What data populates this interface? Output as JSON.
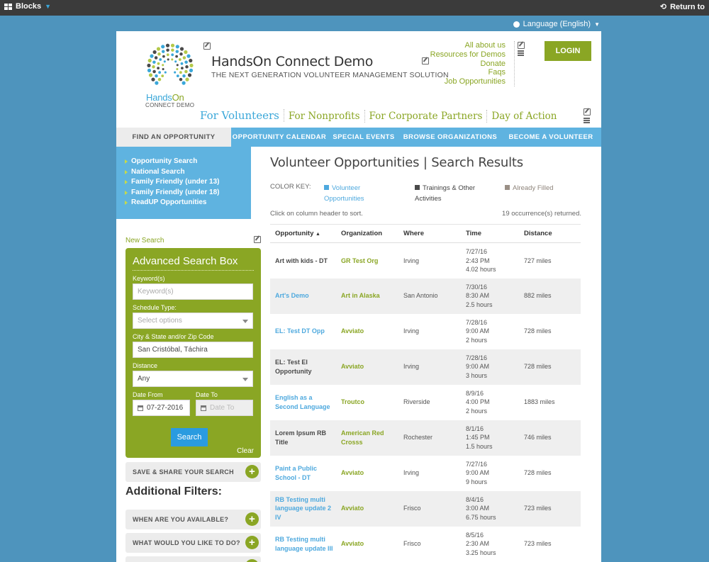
{
  "adminbar": {
    "blocks_label": "Blocks",
    "return_label": "Return to"
  },
  "language": {
    "label": "Language (English)"
  },
  "header": {
    "site_title": "HandsOn Connect Demo",
    "tagline": "THE NEXT GENERATION VOLUNTEER MANAGEMENT SOLUTION",
    "logo_text_a": "Hands",
    "logo_text_b": "On",
    "logo_sub": "CONNECT DEMO",
    "top_links": [
      "All about us",
      "Resources for Demos",
      "Donate",
      "Faqs",
      "Job Opportunities"
    ],
    "login_label": "LOGIN"
  },
  "main_nav": [
    "For Volunteers",
    "For Nonprofits",
    "For Corporate Partners",
    "Day of Action"
  ],
  "sub_nav": [
    "FIND AN OPPORTUNITY",
    "OPPORTUNITY CALENDAR",
    "SPECIAL EVENTS",
    "BROWSE ORGANIZATIONS",
    "BECOME A VOLUNTEER"
  ],
  "sidebar": {
    "links": [
      "Opportunity Search",
      "National Search",
      "Family Friendly (under 13)",
      "Family Friendly (under 18)",
      "ReadUP Opportunities"
    ],
    "new_search": "New Search"
  },
  "search_box": {
    "title": "Advanced Search Box",
    "keyword_label": "Keyword(s)",
    "keyword_placeholder": "Keyword(s)",
    "schedule_label": "Schedule Type:",
    "schedule_placeholder": "Select options",
    "location_label": "City & State and/or Zip Code",
    "location_value": "San Cristóbal, Táchira",
    "distance_label": "Distance",
    "distance_value": "Any",
    "date_from_label": "Date From",
    "date_from_value": "07-27-2016",
    "date_to_label": "Date To",
    "date_to_placeholder": "Date To",
    "search_label": "Search",
    "clear_label": "Clear"
  },
  "filters": {
    "save_share": "SAVE & SHARE YOUR SEARCH",
    "additional_title": "Additional Filters:",
    "when": "WHEN ARE YOU AVAILABLE?",
    "what": "WHAT WOULD YOU LIKE TO DO?"
  },
  "results": {
    "title": "Volunteer Opportunities | Search Results",
    "color_key_label": "COLOR KEY:",
    "color_key": [
      {
        "label_a": "Volunteer",
        "label_b": "Opportunities",
        "color": "#4ea9de"
      },
      {
        "label_a": "Trainings & Other",
        "label_b": "Activities",
        "color": "#4a4a4a"
      },
      {
        "label_a": "Already Filled",
        "label_b": "",
        "color": "#9a8f86"
      }
    ],
    "hint": "Click on column header to sort.",
    "count": "19 occurrence(s) returned.",
    "columns": [
      "Opportunity",
      "Organization",
      "Where",
      "Time",
      "Distance"
    ],
    "rows": [
      {
        "opp": "Art with kids - DT",
        "type": "training",
        "org": "GR Test Org",
        "where": "Irving",
        "date": "7/27/16",
        "clock": "2:43 PM",
        "hours": "4.02 hours",
        "dist": "727 miles"
      },
      {
        "opp": "Art's Demo",
        "type": "volunteer",
        "org": "Art in Alaska",
        "where": "San Antonio",
        "date": "7/30/16",
        "clock": "8:30 AM",
        "hours": "2.5 hours",
        "dist": "882 miles"
      },
      {
        "opp": "EL: Test DT Opp",
        "type": "volunteer",
        "org": "Avviato",
        "where": "Irving",
        "date": "7/28/16",
        "clock": "9:00 AM",
        "hours": "2 hours",
        "dist": "728 miles"
      },
      {
        "opp": "EL: Test El Opportunity",
        "type": "training",
        "org": "Avviato",
        "where": "Irving",
        "date": "7/28/16",
        "clock": "9:00 AM",
        "hours": "3 hours",
        "dist": "728 miles"
      },
      {
        "opp": "English as a Second Language",
        "type": "volunteer",
        "org": "Troutco",
        "where": "Riverside",
        "date": "8/9/16",
        "clock": "4:00 PM",
        "hours": "2 hours",
        "dist": "1883 miles"
      },
      {
        "opp": "Lorem Ipsum RB Title",
        "type": "training",
        "org": "American Red Crosss",
        "where": "Rochester",
        "date": "8/1/16",
        "clock": "1:45 PM",
        "hours": "1.5 hours",
        "dist": "746 miles"
      },
      {
        "opp": "Paint a Public School - DT",
        "type": "volunteer",
        "org": "Avviato",
        "where": "Irving",
        "date": "7/27/16",
        "clock": "9:00 AM",
        "hours": "9 hours",
        "dist": "728 miles"
      },
      {
        "opp": "RB Testing multi language update 2 IV",
        "type": "volunteer",
        "org": "Avviato",
        "where": "Frisco",
        "date": "8/4/16",
        "clock": "3:00 AM",
        "hours": "6.75 hours",
        "dist": "723 miles"
      },
      {
        "opp": "RB Testing multi language update III",
        "type": "volunteer",
        "org": "Avviato",
        "where": "Frisco",
        "date": "8/5/16",
        "clock": "2:30 AM",
        "hours": "3.25 hours",
        "dist": "723 miles"
      }
    ]
  }
}
